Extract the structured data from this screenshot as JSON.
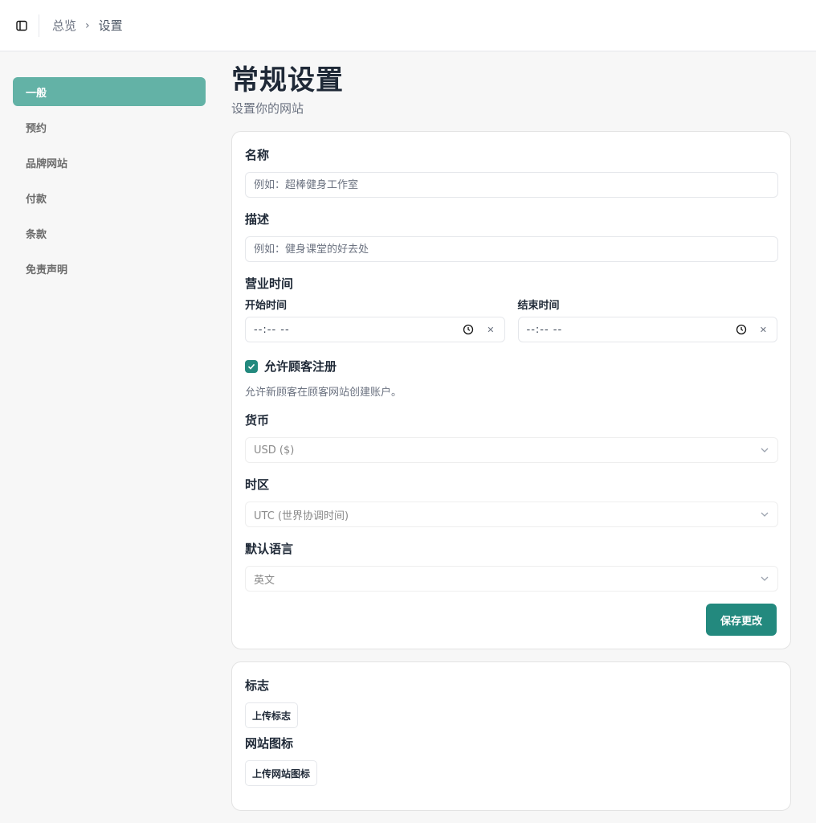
{
  "breadcrumb": {
    "root": "总览",
    "separator": "›",
    "current": "设置"
  },
  "sidebar": {
    "items": [
      {
        "label": "一般",
        "active": true
      },
      {
        "label": "预约"
      },
      {
        "label": "品牌网站"
      },
      {
        "label": "付款"
      },
      {
        "label": "条款"
      },
      {
        "label": "免责声明"
      }
    ]
  },
  "header": {
    "title": "常规设置",
    "subtitle": "设置你的网站"
  },
  "general": {
    "name_label": "名称",
    "name_placeholder": "例如：超棒健身工作室",
    "description_label": "描述",
    "description_placeholder": "例如：健身课堂的好去处",
    "hours_label": "营业时间",
    "start_label": "开始时间",
    "start_value": "--:-- --",
    "end_label": "结束时间",
    "end_value": "--:-- --",
    "clear_glyph": "✕",
    "signup_label": "允许顾客注册",
    "signup_checked": true,
    "signup_help": "允许新顾客在顾客网站创建账户。",
    "currency_label": "货币",
    "currency_value": "USD ($)",
    "timezone_label": "时区",
    "timezone_value": "UTC (世界协调时间)",
    "language_label": "默认语言",
    "language_value": "英文",
    "save_label": "保存更改"
  },
  "branding": {
    "logo_label": "标志",
    "logo_button": "上传标志",
    "favicon_label": "网站图标",
    "favicon_button": "上传网站图标"
  },
  "colors": {
    "accent": "#23897e",
    "active_nav": "#63b2a6"
  }
}
